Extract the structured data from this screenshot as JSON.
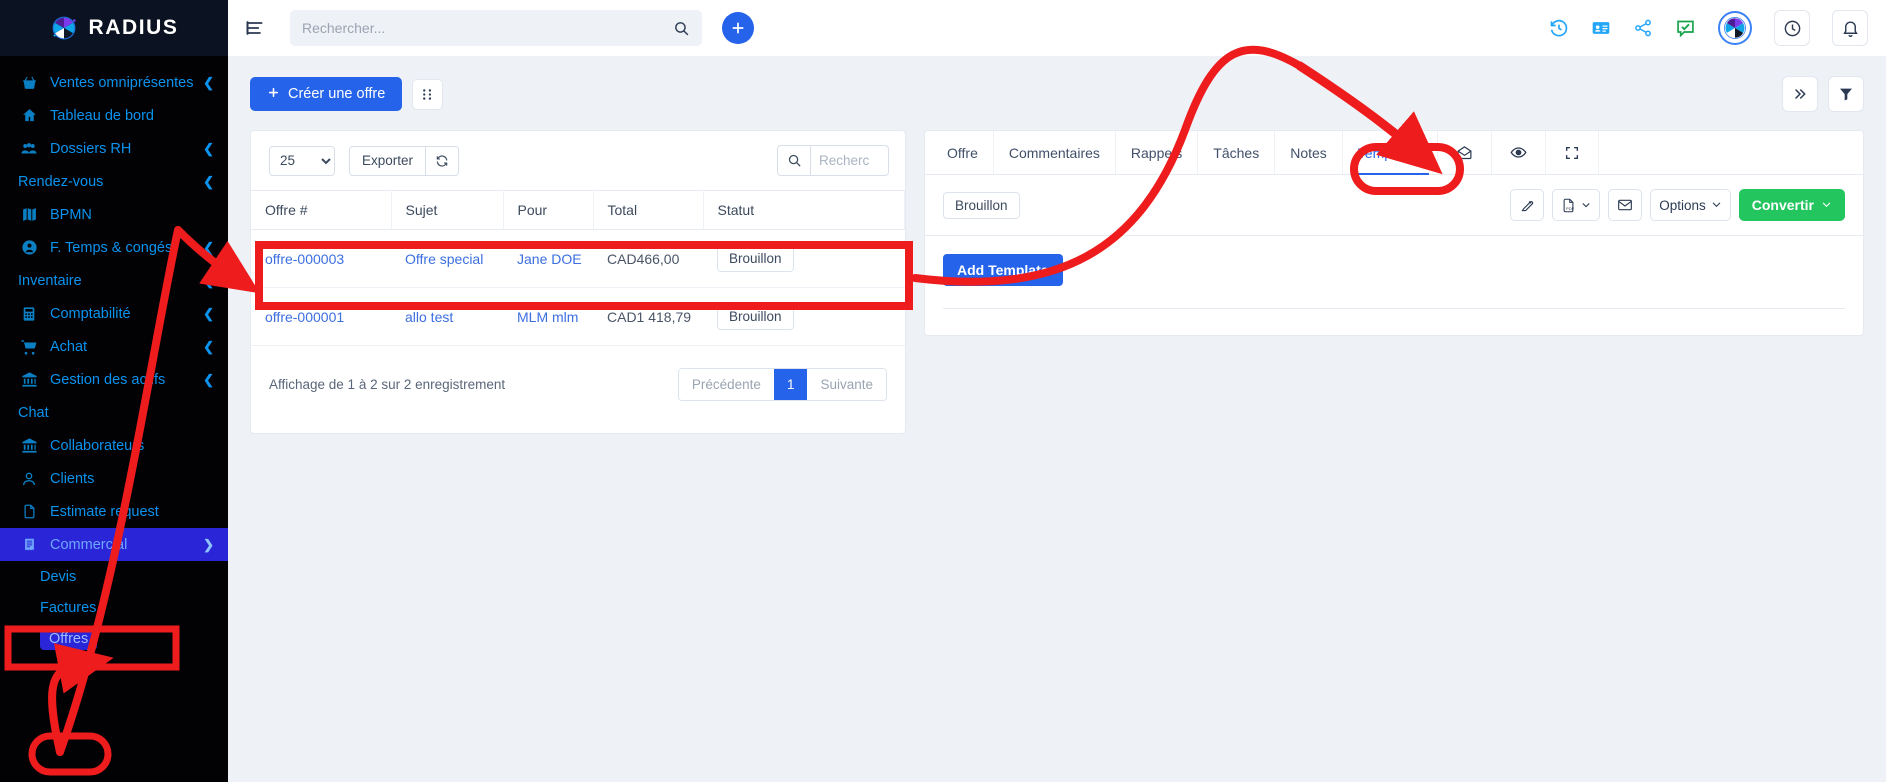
{
  "brand": {
    "name": "RADIUS"
  },
  "topbar": {
    "menu_icon": "hamburger-icon",
    "search_placeholder": "Rechercher...",
    "search_value": "",
    "add_label": "+",
    "icons": [
      "history-icon",
      "contact-card-icon",
      "share-icon",
      "chat-check-icon",
      "avatar-icon",
      "clock-icon",
      "bell-icon"
    ]
  },
  "sidebar": {
    "items": [
      {
        "label": "Ventes omniprésentes",
        "icon": "basket-icon",
        "chevron": true
      },
      {
        "label": "Tableau de bord",
        "icon": "home-icon",
        "chevron": false
      },
      {
        "label": "Dossiers RH",
        "icon": "people-icon",
        "chevron": true
      },
      {
        "label": "Rendez-vous",
        "icon": "",
        "chevron": true
      },
      {
        "label": "BPMN",
        "icon": "map-icon",
        "chevron": false
      },
      {
        "label": "F. Temps & congés",
        "icon": "user-circle-icon",
        "chevron": true
      },
      {
        "label": "Inventaire",
        "icon": "",
        "chevron": true
      },
      {
        "label": "Comptabilité",
        "icon": "calculator-icon",
        "chevron": true
      },
      {
        "label": "Achat",
        "icon": "cart-icon",
        "chevron": true
      },
      {
        "label": "Gestion des actifs",
        "icon": "bank-icon",
        "chevron": true
      },
      {
        "label": "Chat",
        "icon": "",
        "chevron": false
      },
      {
        "label": "Collaborateurs",
        "icon": "bank-icon",
        "chevron": false
      },
      {
        "label": "Clients",
        "icon": "person-icon",
        "chevron": false
      },
      {
        "label": "Estimate request",
        "icon": "file-icon",
        "chevron": false
      },
      {
        "label": "Commercial",
        "icon": "receipt-icon",
        "chevron": true,
        "active": true
      }
    ],
    "subitems": [
      {
        "label": "Devis",
        "selected": false
      },
      {
        "label": "Factures",
        "selected": false
      },
      {
        "label": "Offres",
        "selected": true
      }
    ]
  },
  "content": {
    "create_button": "Créer une offre",
    "grid_icon": "grid-icon",
    "expand_icon": "double-chevron-right-icon",
    "filter_icon": "funnel-icon"
  },
  "table": {
    "page_size": "25",
    "page_size_options": [
      "25"
    ],
    "export_label": "Exporter",
    "refresh_icon": "refresh-icon",
    "search_placeholder": "Recherc",
    "search_value": "",
    "columns": [
      "Offre #",
      "Sujet",
      "Pour",
      "Total",
      "Statut"
    ],
    "rows": [
      {
        "offre": "offre-000003",
        "sujet": "Offre special",
        "pour": "Jane DOE",
        "total": "CAD466,00",
        "statut": "Brouillon"
      },
      {
        "offre": "offre-000001",
        "sujet": "allo test",
        "pour": "MLM mlm",
        "total": "CAD1 418,79",
        "statut": "Brouillon"
      }
    ],
    "pager_info": "Affichage de 1 à 2 sur 2 enregistrement",
    "pager_prev": "Précédente",
    "pager_current": "1",
    "pager_next": "Suivante"
  },
  "detail": {
    "tabs": [
      {
        "label": "Offre",
        "active": false
      },
      {
        "label": "Commentaires",
        "active": false
      },
      {
        "label": "Rappels",
        "active": false
      },
      {
        "label": "Tâches",
        "active": false
      },
      {
        "label": "Notes",
        "active": false
      },
      {
        "label": "Templates",
        "active": true
      }
    ],
    "tab_icons": [
      "envelope-open-icon",
      "eye-icon",
      "expand-icon"
    ],
    "status": "Brouillon",
    "actions": {
      "edit_icon": "edit-pencil-icon",
      "pdf_icon": "pdf-file-icon",
      "mail_icon": "envelope-icon",
      "options_label": "Options",
      "convert_label": "Convertir"
    },
    "add_template_label": "Add Template"
  },
  "colors": {
    "accent_blue": "#2563eb",
    "sidebar_bg": "#020205",
    "sidebar_link": "#0b93ee",
    "active_nav": "#2a25d6",
    "green": "#22c55e",
    "annotation_red": "#ee1c1c"
  }
}
